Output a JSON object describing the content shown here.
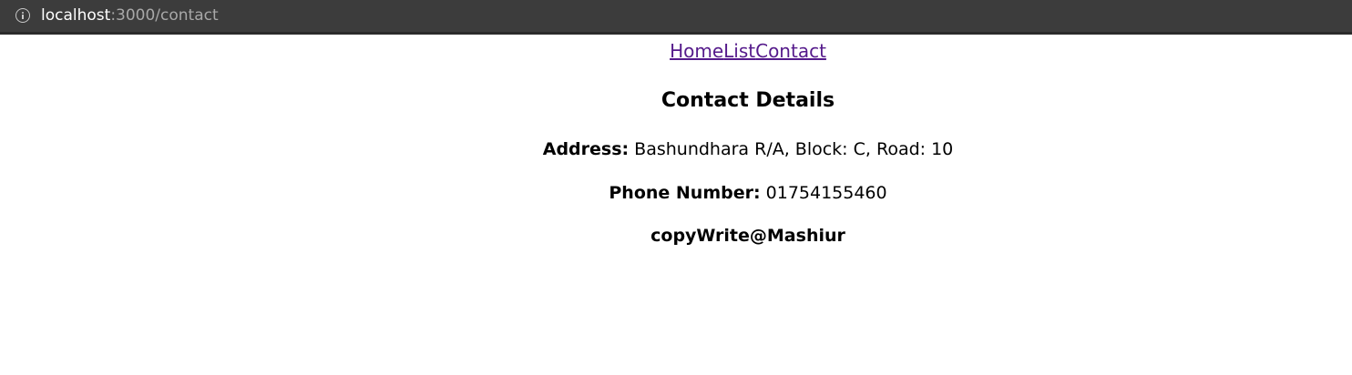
{
  "browser": {
    "url_host": "localhost",
    "url_path": ":3000/contact"
  },
  "nav": {
    "links": [
      "Home",
      "List",
      "Contact"
    ]
  },
  "contact": {
    "heading": "Contact Details",
    "address_label": "Address:",
    "address_value": "Bashundhara R/A, Block: C, Road: 10",
    "phone_label": "Phone Number:",
    "phone_value": "01754155460",
    "copyright": "copyWrite@Mashiur"
  },
  "colors": {
    "link": "#551a8b",
    "browser_bar": "#3c3c3c"
  }
}
